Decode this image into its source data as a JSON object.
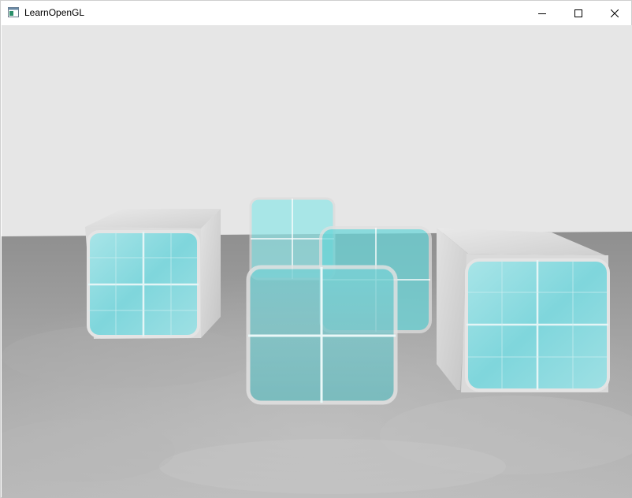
{
  "window": {
    "title": "LearnOpenGL",
    "app_icon": "opengl-window-icon",
    "controls": [
      {
        "name": "minimize",
        "icon": "minimize-icon"
      },
      {
        "name": "maximize",
        "icon": "maximize-icon"
      },
      {
        "name": "close",
        "icon": "close-icon"
      }
    ]
  },
  "scene": {
    "description_objects": [
      "marble-cube-left",
      "marble-cube-right",
      "glass-window-back",
      "glass-window-middle",
      "glass-window-front",
      "marble-floor",
      "sky-background"
    ],
    "colors": {
      "background": "#e6e6e6",
      "floor": "#a0a0a0",
      "marble": "#d9d9d9",
      "glass_tint": "#5ad8dc",
      "window_frame": "#e8e8e8"
    }
  }
}
